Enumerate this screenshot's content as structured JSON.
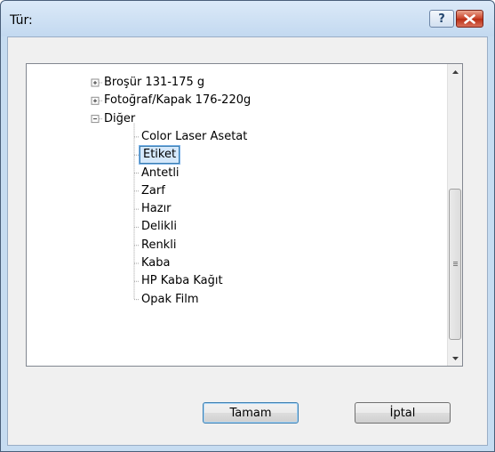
{
  "dialog": {
    "title": "Tür:"
  },
  "title_buttons": {
    "help_glyph": "?"
  },
  "tree": {
    "groups": [
      {
        "label": "Broşür 131-175 g",
        "state": "collapsed"
      },
      {
        "label": "Fotoğraf/Kapak 176-220g",
        "state": "collapsed"
      },
      {
        "label": "Diğer",
        "state": "expanded"
      }
    ],
    "children": [
      {
        "label": "Color Laser Asetat"
      },
      {
        "label": "Etiket",
        "selected": true
      },
      {
        "label": "Antetli"
      },
      {
        "label": "Zarf"
      },
      {
        "label": "Hazır"
      },
      {
        "label": "Delikli"
      },
      {
        "label": "Renkli"
      },
      {
        "label": "Kaba"
      },
      {
        "label": "HP Kaba Kağıt"
      },
      {
        "label": "Opak Film"
      }
    ]
  },
  "buttons": {
    "ok": "Tamam",
    "cancel": "İptal"
  },
  "colors": {
    "selection_border": "#3c7fb1",
    "selection_fill": "#d5e8fb",
    "close_red": "#c94128"
  }
}
